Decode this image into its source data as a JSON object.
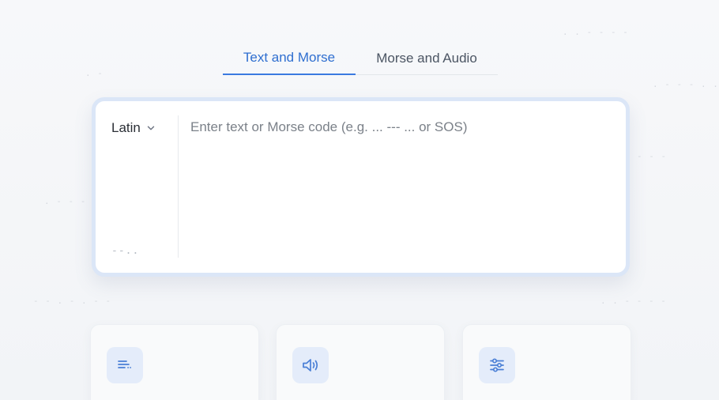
{
  "tabs": [
    {
      "label": "Text and Morse",
      "active": true
    },
    {
      "label": "Morse and Audio",
      "active": false
    }
  ],
  "converter": {
    "language": "Latin",
    "input_value": "",
    "input_placeholder": "Enter text or Morse code (e.g. ... --- ... or SOS)",
    "morse_mark": "--.."
  },
  "cards": [
    {
      "icon": "text-lines-icon"
    },
    {
      "icon": "speaker-icon"
    },
    {
      "icon": "sliders-icon"
    }
  ],
  "colors": {
    "accent": "#3b7ae0",
    "active_tab_text": "#2f6fd0",
    "icon_bg": "#e4ecfa"
  }
}
